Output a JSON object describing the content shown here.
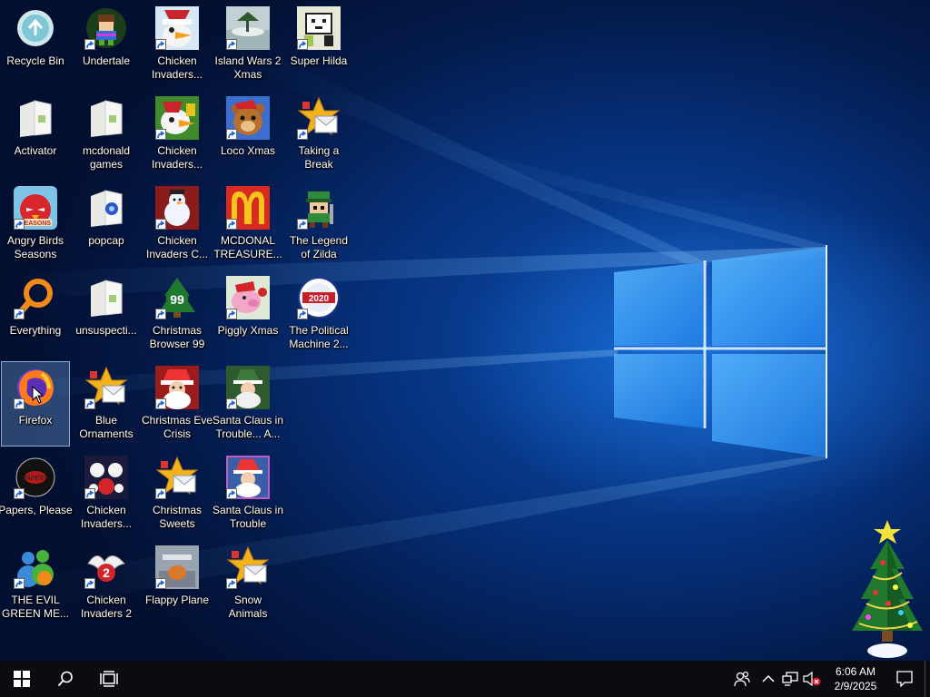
{
  "desktop": {
    "icons": [
      {
        "id": "recycle-bin",
        "label": "Recycle Bin",
        "shortcut": false,
        "art": "recycle"
      },
      {
        "id": "undertale",
        "label": "Undertale",
        "shortcut": true,
        "art": "undertale"
      },
      {
        "id": "chicken-invaders-1",
        "label": "Chicken\nInvaders...",
        "shortcut": true,
        "art": "chicken"
      },
      {
        "id": "island-wars-2-xmas",
        "label": "Island Wars 2\nXmas",
        "shortcut": true,
        "art": "island"
      },
      {
        "id": "super-hilda",
        "label": "Super Hilda",
        "shortcut": true,
        "art": "hilda"
      },
      {
        "id": "activator",
        "label": "Activator",
        "shortcut": false,
        "art": "folder"
      },
      {
        "id": "mcdonald-games",
        "label": "mcdonald\ngames",
        "shortcut": false,
        "art": "folder"
      },
      {
        "id": "chicken-invaders-2nd",
        "label": "Chicken\nInvaders...",
        "shortcut": true,
        "art": "chicken2"
      },
      {
        "id": "loco-xmas",
        "label": "Loco Xmas",
        "shortcut": true,
        "art": "bear"
      },
      {
        "id": "taking-a-break",
        "label": "Taking a\nBreak",
        "shortcut": true,
        "art": "popcap"
      },
      {
        "id": "angry-birds-seasons",
        "label": "Angry Birds\nSeasons",
        "shortcut": true,
        "art": "angry"
      },
      {
        "id": "popcap",
        "label": "popcap",
        "shortcut": false,
        "art": "folderblue"
      },
      {
        "id": "chicken-invaders-c",
        "label": "Chicken\nInvaders C...",
        "shortcut": true,
        "art": "snowman"
      },
      {
        "id": "mcdonal-treasure",
        "label": "MCDONAL\nTREASURE...",
        "shortcut": true,
        "art": "mcd"
      },
      {
        "id": "legend-of-zilda",
        "label": "The Legend\nof Zilda",
        "shortcut": true,
        "art": "zilda"
      },
      {
        "id": "everything",
        "label": "Everything",
        "shortcut": true,
        "art": "everything"
      },
      {
        "id": "unsuspecti",
        "label": "unsuspecti...",
        "shortcut": false,
        "art": "folder"
      },
      {
        "id": "christmas-browser-99",
        "label": "Christmas\nBrowser 99",
        "shortcut": true,
        "art": "xtree"
      },
      {
        "id": "piggly-xmas",
        "label": "Piggly Xmas",
        "shortcut": true,
        "art": "pig"
      },
      {
        "id": "political-machine",
        "label": "The Political\nMachine 2...",
        "shortcut": true,
        "art": "political"
      },
      {
        "id": "firefox",
        "label": "Firefox",
        "shortcut": true,
        "art": "firefox",
        "selected": true
      },
      {
        "id": "blue-ornaments",
        "label": "Blue\nOrnaments",
        "shortcut": true,
        "art": "popcap"
      },
      {
        "id": "christmas-eve-crisis",
        "label": "Christmas Eve\nCrisis",
        "shortcut": true,
        "art": "santa"
      },
      {
        "id": "santa-claus-trouble-a",
        "label": "Santa Claus in\nTrouble... A...",
        "shortcut": true,
        "art": "santa2"
      },
      {
        "id": "papers-please",
        "label": "Papers, Please",
        "shortcut": true,
        "art": "papers"
      },
      {
        "id": "chicken-invaders-balls",
        "label": "Chicken\nInvaders...",
        "shortcut": true,
        "art": "balls"
      },
      {
        "id": "christmas-sweets",
        "label": "Christmas\nSweets",
        "shortcut": true,
        "art": "popcap"
      },
      {
        "id": "santa-claus-trouble",
        "label": "Santa Claus in\nTrouble",
        "shortcut": true,
        "art": "santa3"
      },
      {
        "id": "evil-green-me",
        "label": "THE EVIL\nGREEN ME...",
        "shortcut": true,
        "art": "msn"
      },
      {
        "id": "chicken-invaders-2",
        "label": "Chicken\nInvaders 2",
        "shortcut": true,
        "art": "chickenwing"
      },
      {
        "id": "flappy-plane",
        "label": "Flappy Plane",
        "shortcut": true,
        "art": "flappy"
      },
      {
        "id": "snow-animals",
        "label": "Snow\nAnimals",
        "shortcut": true,
        "art": "popcap"
      }
    ]
  },
  "taskbar": {
    "time": "6:06 AM",
    "date": "2/9/2025"
  },
  "colors": {
    "taskbar_bg": "#0a0c12",
    "wallpaper_accent": "#3aa0ff",
    "selection": "#78aae6"
  }
}
